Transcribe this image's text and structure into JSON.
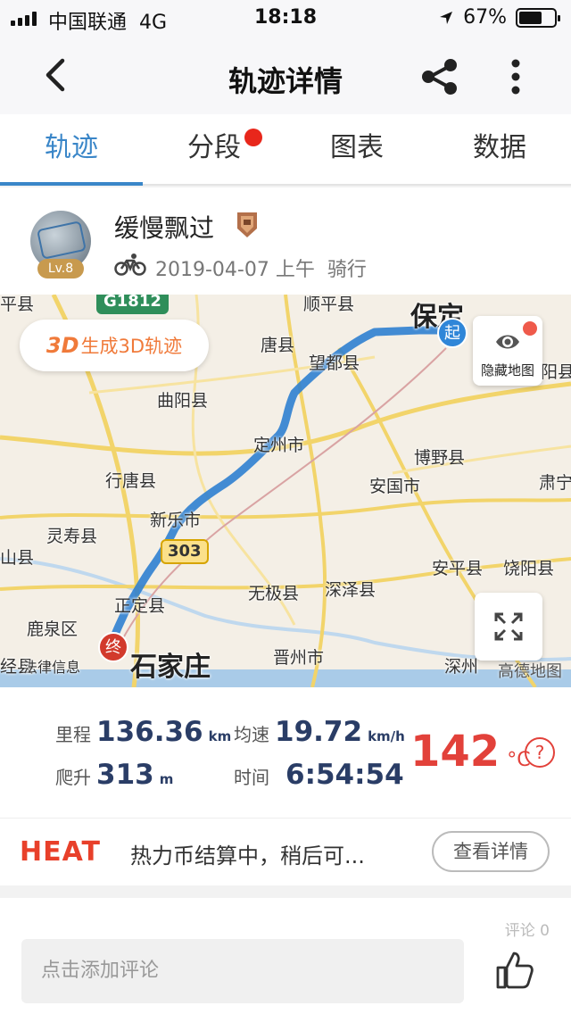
{
  "status_bar": {
    "carrier": "中国联通",
    "network": "4G",
    "time": "18:18",
    "battery": "67%",
    "battery_level": 0.67
  },
  "header": {
    "title": "轨迹详情",
    "back_icon": "chevron-left-icon",
    "share_icon": "share-icon",
    "more_icon": "more-vertical-icon"
  },
  "tabs": [
    {
      "label": "轨迹",
      "active": true
    },
    {
      "label": "分段",
      "badge": true
    },
    {
      "label": "图表"
    },
    {
      "label": "数据"
    }
  ],
  "user": {
    "name": "缓慢飘过",
    "level": "Lv.8",
    "date": "2019-04-07 上午",
    "activity": "骑行"
  },
  "map": {
    "btn_3d_prefix": "3D",
    "btn_3d_label": "生成3D轨迹",
    "hide_map_label": "隐藏地图",
    "start_marker": "起",
    "end_marker": "终",
    "provider": "高德地图",
    "route_color": "#3a86d8",
    "labels": {
      "baoding": "保定",
      "shijiazhuang": "石家庄",
      "tangxian": "唐县",
      "wangdu": "望都县",
      "shunping": "顺平县",
      "quyang": "曲阳县",
      "dingzhou": "定州市",
      "boye": "博野县",
      "anguo": "安国市",
      "xingtang": "行唐县",
      "xinle": "新乐市",
      "lingshou": "灵寿县",
      "anping": "安平县",
      "raoyang": "饶阳县",
      "wuji": "无极县",
      "shenze": "深泽县",
      "zhengding": "正定县",
      "luquan": "鹿泉区",
      "jinzhou": "晋州市",
      "shenzhou": "深州",
      "highway_g1812": "G1812",
      "highway_303": "303",
      "shan": "山县",
      "pingxian": "平县",
      "suning": "肃宁",
      "yangxian": "阳县",
      "jiedai": "法律信息",
      "jing": "经县"
    }
  },
  "stats": {
    "distance_label": "里程",
    "distance_value": "136.36",
    "distance_unit": "km",
    "speed_label": "均速",
    "speed_value": "19.72",
    "speed_unit": "km/h",
    "climb_label": "爬升",
    "climb_value": "313",
    "climb_unit": "m",
    "time_label": "时间",
    "time_value": "6:54:54",
    "temp_value": "142",
    "temp_unit": "°C",
    "help": "?"
  },
  "heat": {
    "logo": "HEAT",
    "text": "热力币结算中，稍后可...",
    "detail_button": "查看详情"
  },
  "comment": {
    "faded": "评论 0",
    "placeholder": "点击添加评论",
    "like_icon": "thumbs-up-icon"
  }
}
